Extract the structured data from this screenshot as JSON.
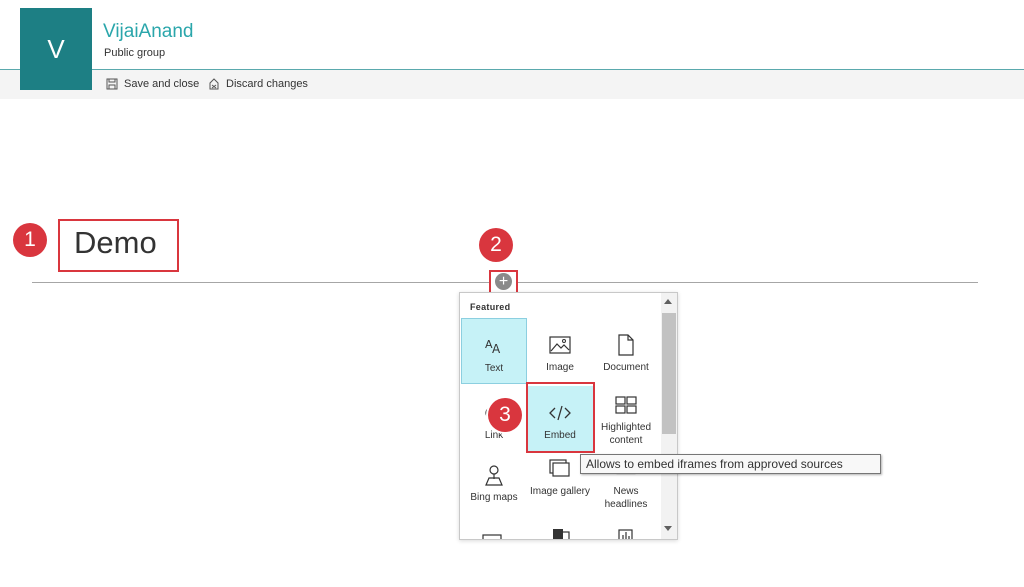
{
  "header": {
    "logo_letter": "V",
    "site_title": "VijaiAnand",
    "site_subtitle": "Public group"
  },
  "command_bar": {
    "save_close_label": "Save and close",
    "discard_label": "Discard changes"
  },
  "page": {
    "title": "Demo"
  },
  "annotations": [
    "1",
    "2",
    "3"
  ],
  "add_button": {
    "symbol": "+"
  },
  "toolbox": {
    "heading": "Featured",
    "tiles": [
      {
        "label": "Text",
        "icon": "text-icon",
        "selected": true
      },
      {
        "label": "Image",
        "icon": "image-icon"
      },
      {
        "label": "Document",
        "icon": "document-icon"
      },
      {
        "label": "Link",
        "icon": "link-icon"
      },
      {
        "label": "Embed",
        "icon": "embed-code-icon"
      },
      {
        "label": "Highlighted content",
        "icon": "highlighted-content-icon"
      },
      {
        "label": "Bing maps",
        "icon": "map-pin-icon"
      },
      {
        "label": "Image gallery",
        "icon": "gallery-icon"
      },
      {
        "label": "News headlines",
        "icon": "news-icon"
      }
    ],
    "tooltip": "Allows to embed iframes from approved sources"
  },
  "colors": {
    "accent": "#1d7f84",
    "title_teal": "#2aa6ab",
    "annotation_red": "#d9363e",
    "tile_highlight": "#c6f2f7"
  }
}
